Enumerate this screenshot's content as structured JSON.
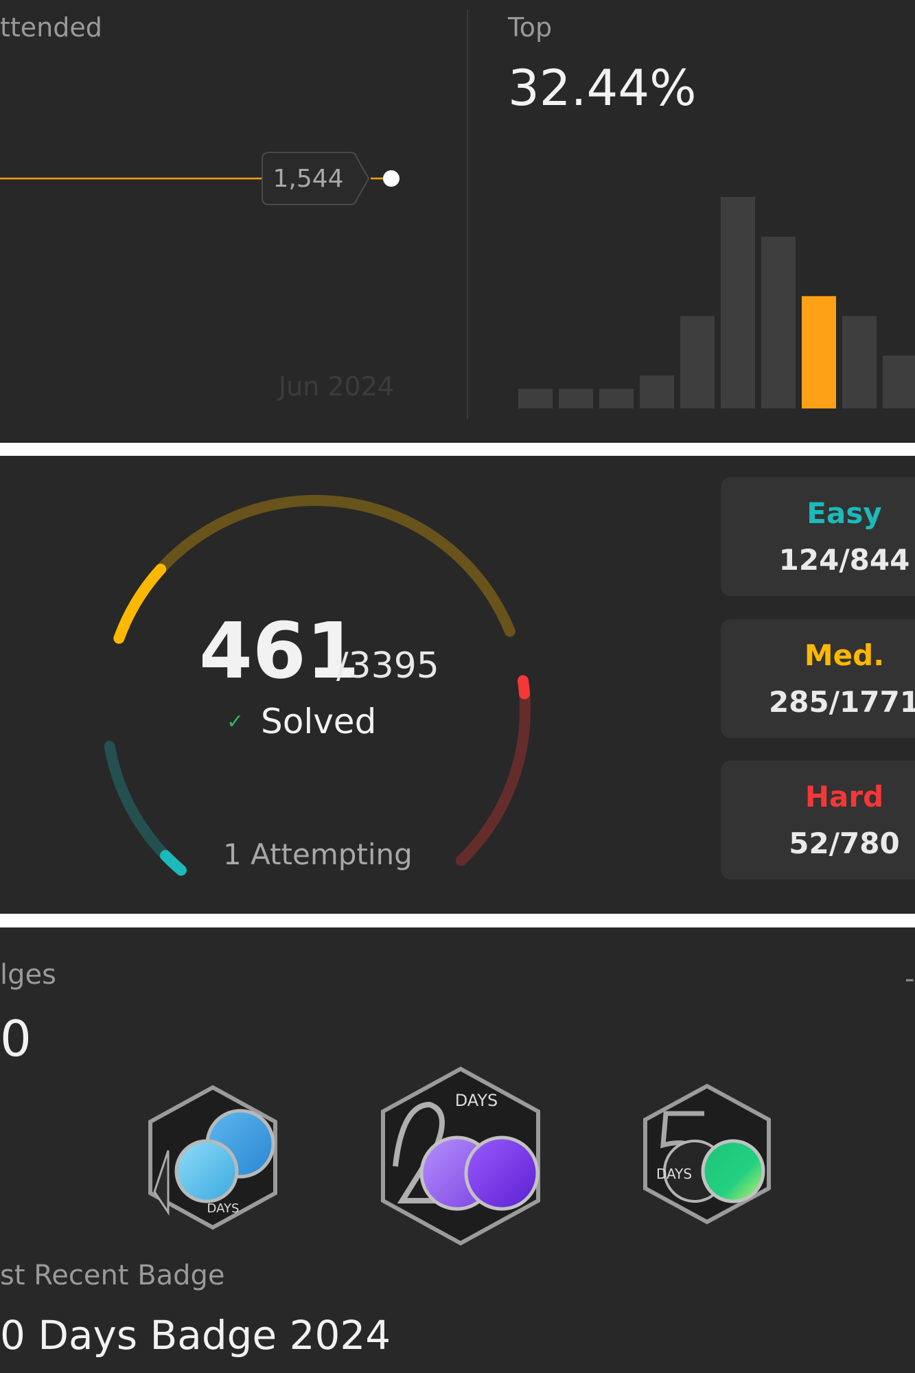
{
  "contest": {
    "attended_label": "ttended",
    "rating_tooltip": "1,544",
    "month_label": "Jun 2024",
    "line_color": "#ffa116",
    "top_label": "Top",
    "top_value": "32.44%",
    "histogram_highlight_color": "#ffa116",
    "histogram_bar_color": "#3e3e3e"
  },
  "chart_data": {
    "type": "bar",
    "values": [
      1.5,
      1.5,
      1.5,
      2.5,
      7,
      16,
      13,
      8.5,
      7,
      4
    ],
    "highlight_index": 7,
    "ylim": [
      0,
      16
    ]
  },
  "progress": {
    "solved": "461",
    "total": "/3395",
    "check_icon": "✓",
    "solved_label": "Solved",
    "attempting_label": "1 Attempting",
    "easy_solved": 124,
    "easy_total": 844,
    "medium_solved": 285,
    "medium_total": 1771,
    "hard_solved": 52,
    "hard_total": 780,
    "easy_color": "#1cbaba",
    "medium_color": "#ffb800",
    "hard_color": "#f63737"
  },
  "difficulty_cards": [
    {
      "label": "Easy",
      "value": "124/844",
      "color": "#1cbaba"
    },
    {
      "label": "Med.",
      "value": "285/1771",
      "color": "#ffb800"
    },
    {
      "label": "Hard",
      "value": "52/780",
      "color": "#f63737"
    }
  ],
  "badges": {
    "label": "lges",
    "count": "0",
    "icons": [
      "100-days-badge-icon",
      "200-days-badge-icon",
      "50-days-badge-icon"
    ],
    "days_text": "DAYS",
    "recent_label": "st Recent Badge",
    "recent_name": "0 Days Badge 2024",
    "more_icon": "-"
  }
}
